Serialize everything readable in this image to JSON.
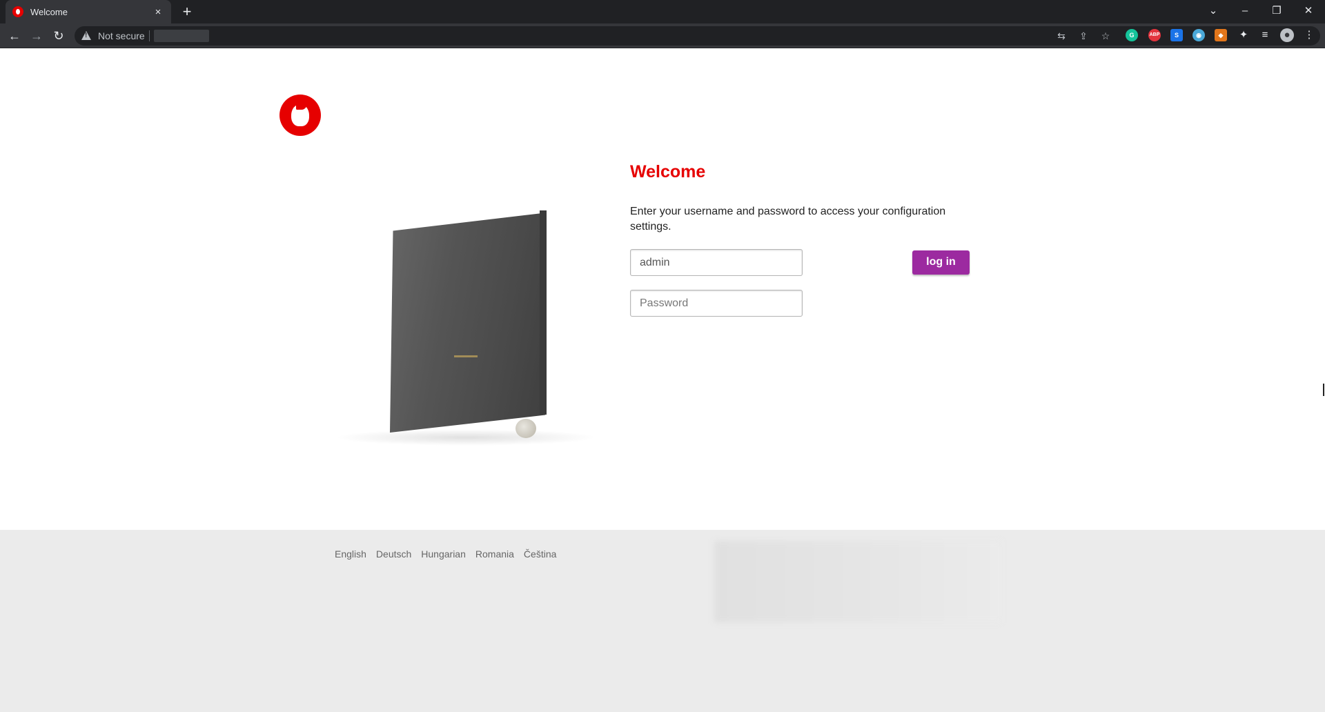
{
  "browser": {
    "tab_title": "Welcome",
    "tab_close": "×",
    "new_tab": "+",
    "security_label": "Not secure",
    "window_controls": {
      "list": "⌄",
      "minimize": "–",
      "restore": "❐",
      "close": "✕"
    },
    "nav": {
      "back": "←",
      "forward": "→",
      "reload": "↻"
    },
    "omnibox_icons": [
      "translate-icon",
      "share-icon",
      "star-icon"
    ],
    "extensions": [
      {
        "name": "grammarly-icon",
        "label": "G",
        "color": "#15c39a"
      },
      {
        "name": "adblock-plus-icon",
        "label": "ABP",
        "color": "#e3343e"
      },
      {
        "name": "s-extension-icon",
        "label": "S",
        "color": "#1a73e8"
      },
      {
        "name": "globe-extension-icon",
        "label": "◉",
        "color": "#4aa8d8"
      },
      {
        "name": "metamask-icon",
        "label": "◆",
        "color": "#e2761b"
      }
    ],
    "toolbar_icons": [
      "puzzle-icon",
      "reading-list-icon",
      "profile-avatar",
      "menu-kebab-icon"
    ]
  },
  "brand": {
    "accent": "#e60000",
    "button_color": "#9c2aa0",
    "footer_bg": "#ebebeb"
  },
  "login": {
    "title": "Welcome",
    "intro": "Enter your username and password to access your configuration settings.",
    "username_value": "admin",
    "password_placeholder": "Password",
    "login_button": "log in"
  },
  "footer": {
    "languages": [
      "English",
      "Deutsch",
      "Hungarian",
      "Romania",
      "Čeština"
    ]
  }
}
